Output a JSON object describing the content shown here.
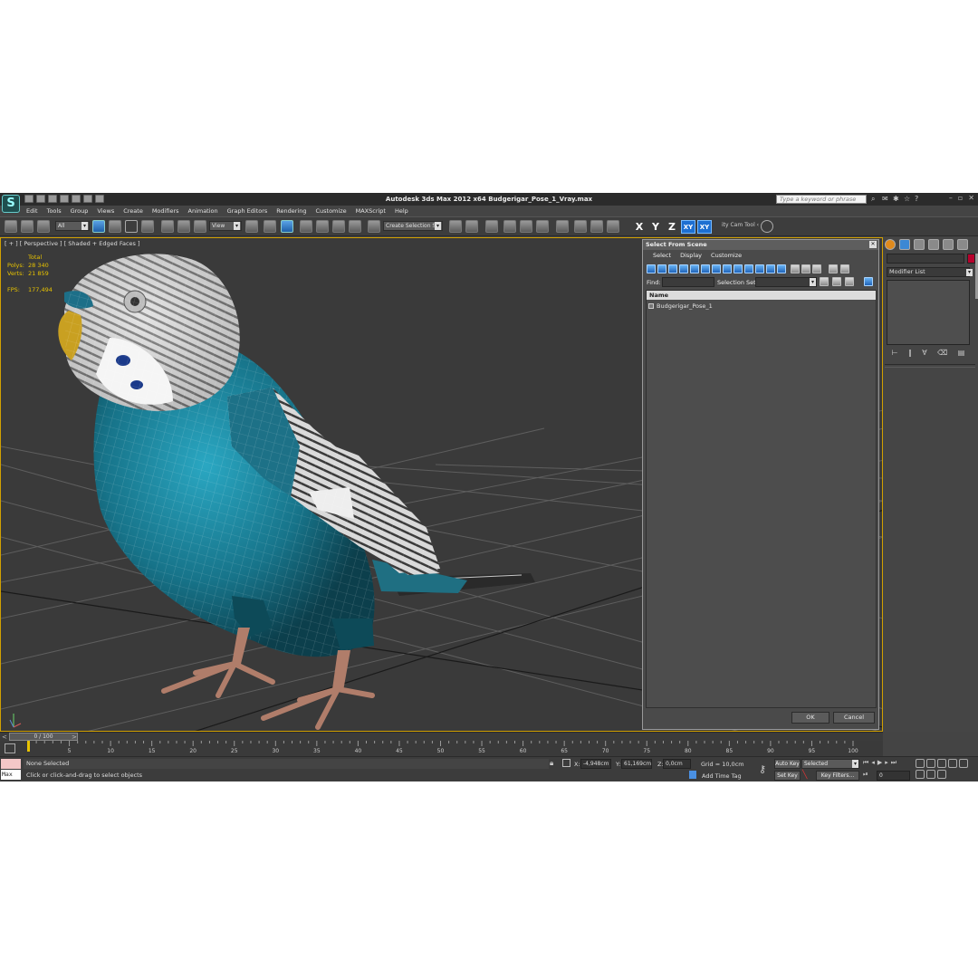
{
  "app": {
    "logo_icon": "3ds-max-logo-icon",
    "title": "Autodesk 3ds Max  2012 x64     Budgerigar_Pose_1_Vray.max",
    "search_placeholder": "Type a keyword or phrase"
  },
  "menu": [
    "Edit",
    "Tools",
    "Group",
    "Views",
    "Create",
    "Modifiers",
    "Animation",
    "Graph Editors",
    "Rendering",
    "Customize",
    "MAXScript",
    "Help"
  ],
  "toolbar": {
    "filter_value": "All",
    "ref_coord": "View",
    "selection_set_placeholder": "Create Selection Se",
    "axis_x": "X",
    "axis_y": "Y",
    "axis_z": "Z",
    "axis_xy": "XY",
    "axis_xy2": "XY",
    "cam_tool": "ity Cam Tool ‹"
  },
  "viewport": {
    "label": "[ + ] [ Perspective ] [ Shaded + Edged Faces ]",
    "stats": {
      "total_label": "Total",
      "polys_label": "Polys:",
      "polys_value": "28 340",
      "verts_label": "Verts:",
      "verts_value": "21 859",
      "fps_label": "FPS:",
      "fps_value": "177,494"
    },
    "colors": {
      "body": "#1b7f95",
      "head": "#d7d7d7",
      "feet": "#b07d6a",
      "grid": "#5c5c5c",
      "background": "#3a3a3a"
    }
  },
  "dialog": {
    "title": "Select From Scene",
    "menu": [
      "Select",
      "Display",
      "Customize"
    ],
    "find_label": "Find:",
    "find_value": "",
    "selection_set_label": "Selection Set:",
    "list_header": "Name",
    "items": [
      "Budgerigar_Pose_1"
    ],
    "ok_label": "OK",
    "cancel_label": "Cancel"
  },
  "command_panel": {
    "modifier_list": "Modifier List",
    "color_swatch": "#b8002c"
  },
  "timeline": {
    "slider_label": "0 / 100",
    "ticks": [
      0,
      5,
      10,
      15,
      20,
      25,
      30,
      35,
      40,
      45,
      50,
      55,
      60,
      65,
      70,
      75,
      80,
      85,
      90,
      95,
      100
    ]
  },
  "status": {
    "maxscript_label": "Max",
    "selection": "None Selected",
    "prompt": "Click or click-and-drag to select objects",
    "x_label": "X:",
    "x_value": "-4,948cm",
    "y_label": "Y:",
    "y_value": "61,169cm",
    "z_label": "Z:",
    "z_value": "0,0cm",
    "grid": "Grid = 10,0cm",
    "add_time_tag": "Add Time Tag",
    "auto_key": "Auto Key",
    "set_key": "Set Key",
    "selected_option": "Selected",
    "key_filters": "Key Filters...",
    "frame": "0"
  }
}
